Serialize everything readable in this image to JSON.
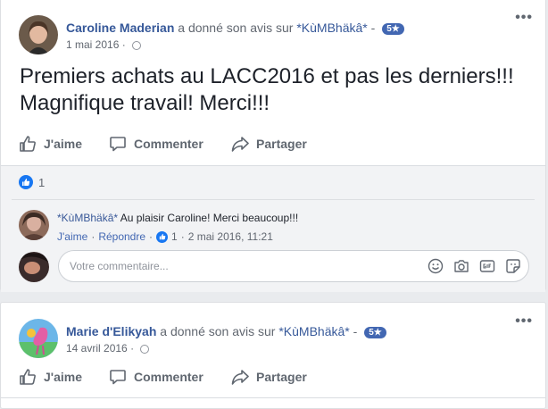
{
  "post1": {
    "author": "Caroline Maderian",
    "verb": "a donné son avis sur",
    "page": "*KùMBhäkâ*",
    "separator": "-",
    "rating": "5★",
    "date": "1 mai 2016",
    "dot": "·",
    "text": "Premiers achats au LACC2016 et pas les derniers!!! Magnifique travail! Merci!!!",
    "actions": {
      "like": "J'aime",
      "comment": "Commenter",
      "share": "Partager"
    },
    "reaction_count": "1",
    "comment": {
      "author": "*KùMBhäkâ*",
      "text": "Au plaisir Caroline! Merci beaucoup!!!",
      "like": "J'aime",
      "reply": "Répondre",
      "likes": "1",
      "timestamp": "2 mai 2016, 11:21",
      "dot": "·"
    },
    "composer": {
      "placeholder": "Votre commentaire..."
    }
  },
  "post2": {
    "author": "Marie d'Elikyah",
    "verb": "a donné son avis sur",
    "page": "*KùMBhäkâ*",
    "separator": "-",
    "rating": "5★",
    "date": "14 avril 2016",
    "dot": "·",
    "actions": {
      "like": "J'aime",
      "comment": "Commenter",
      "share": "Partager"
    }
  },
  "more_glyph": "•••",
  "colors": {
    "link": "#365899",
    "badge": "#4267b2",
    "like_blue": "#1877f2",
    "background": "#e9ebee"
  }
}
